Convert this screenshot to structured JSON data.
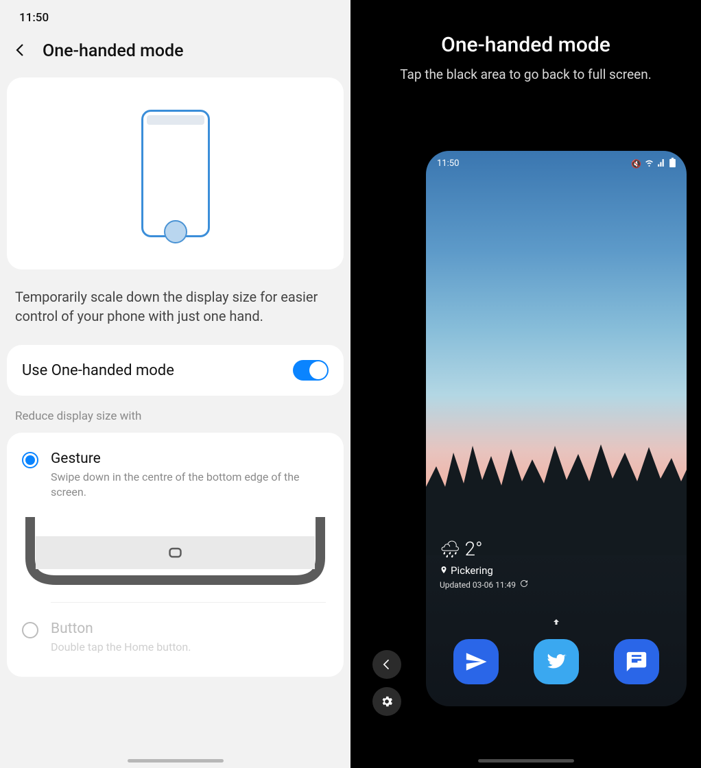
{
  "left": {
    "status_time": "11:50",
    "header_title": "One-handed mode",
    "description": "Temporarily scale down the display size for easier control of your phone with just one hand.",
    "toggle_label": "Use One-handed mode",
    "toggle_on": true,
    "section_label": "Reduce display size with",
    "options": [
      {
        "title": "Gesture",
        "subtitle": "Swipe down in the centre of the bottom edge of the screen.",
        "checked": true
      },
      {
        "title": "Button",
        "subtitle": "Double tap the Home button.",
        "checked": false
      }
    ]
  },
  "right": {
    "title": "One-handed mode",
    "subtitle": "Tap the black area to go back to full screen.",
    "mini": {
      "status_time": "11:50",
      "weather": {
        "temp": "2°",
        "location": "Pickering",
        "updated": "Updated 03-06 11:49"
      },
      "dock_icons": [
        "send-icon",
        "twitter-icon",
        "messages-icon"
      ]
    }
  },
  "colors": {
    "accent": "#0a84ff"
  }
}
